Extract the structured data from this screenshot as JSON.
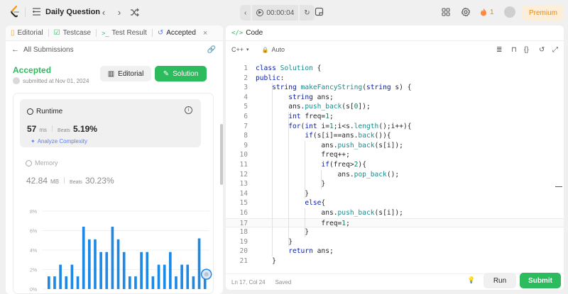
{
  "topbar": {
    "title": "Daily Question",
    "timer": "00:00:04",
    "fire_count": "1",
    "premium": "Premium"
  },
  "left": {
    "tabs": [
      {
        "label": "Editorial"
      },
      {
        "label": "Testcase"
      },
      {
        "label": "Test Result"
      },
      {
        "label": "Accepted"
      }
    ],
    "back_label": "All Submissions",
    "status": "Accepted",
    "submitted": "submitted at Nov 01, 2024",
    "editorial_btn": "Editorial",
    "solution_btn": "Solution",
    "runtime": {
      "title": "Runtime",
      "value": "57",
      "unit": "ms",
      "beats_label": "Beats",
      "beats": "5.19%",
      "analyze": "Analyze Complexity"
    },
    "memory": {
      "title": "Memory",
      "value": "42.84",
      "unit": "MB",
      "beats_label": "Beats",
      "beats": "30.23%"
    }
  },
  "chart_data": {
    "type": "bar",
    "ylim": [
      0,
      8
    ],
    "ytick_labels": [
      "8%",
      "6%",
      "4%",
      "2%",
      "0%"
    ],
    "grid": true,
    "values": [
      1.3,
      1.3,
      2.5,
      1.3,
      2.5,
      1.3,
      6.4,
      5.1,
      5.1,
      3.8,
      3.8,
      6.4,
      5.1,
      3.8,
      1.3,
      1.3,
      3.8,
      3.8,
      1.3,
      2.5,
      2.5,
      3.8,
      1.3,
      2.5,
      2.5,
      1.3,
      5.2,
      1.3
    ],
    "highlight_index": 27,
    "color": "#1e88e5"
  },
  "right": {
    "tab": "Code",
    "language": "C++",
    "mode": "Auto",
    "code_lines": [
      "class Solution {",
      "public:",
      "    string makeFancyString(string s) {",
      "        string ans;",
      "        ans.push_back(s[0]);",
      "        int freq=1;",
      "        for(int i=1;i<s.length();i++){",
      "            if(s[i]==ans.back()){",
      "                ans.push_back(s[i]);",
      "                freq++;",
      "                if(freq>2){",
      "                    ans.pop_back();",
      "                }",
      "            }",
      "            else{",
      "                ans.push_back(s[i]);",
      "                freq=1;",
      "            }",
      "        }",
      "        return ans;",
      "    }"
    ],
    "line_numbers": [
      "1",
      "2",
      "3",
      "4",
      "5",
      "6",
      "7",
      "8",
      "9",
      "10",
      "11",
      "12",
      "13",
      "14",
      "15",
      "16",
      "17",
      "18",
      "19",
      "20",
      "21"
    ],
    "current_line": 17,
    "cursor": "Ln 17, Col 24",
    "saved": "Saved",
    "run_btn": "Run",
    "submit_btn": "Submit"
  },
  "colors": {
    "accent_green": "#2cbb5d",
    "premium_orange": "#e28a17",
    "link_blue": "#5b7cf4"
  }
}
